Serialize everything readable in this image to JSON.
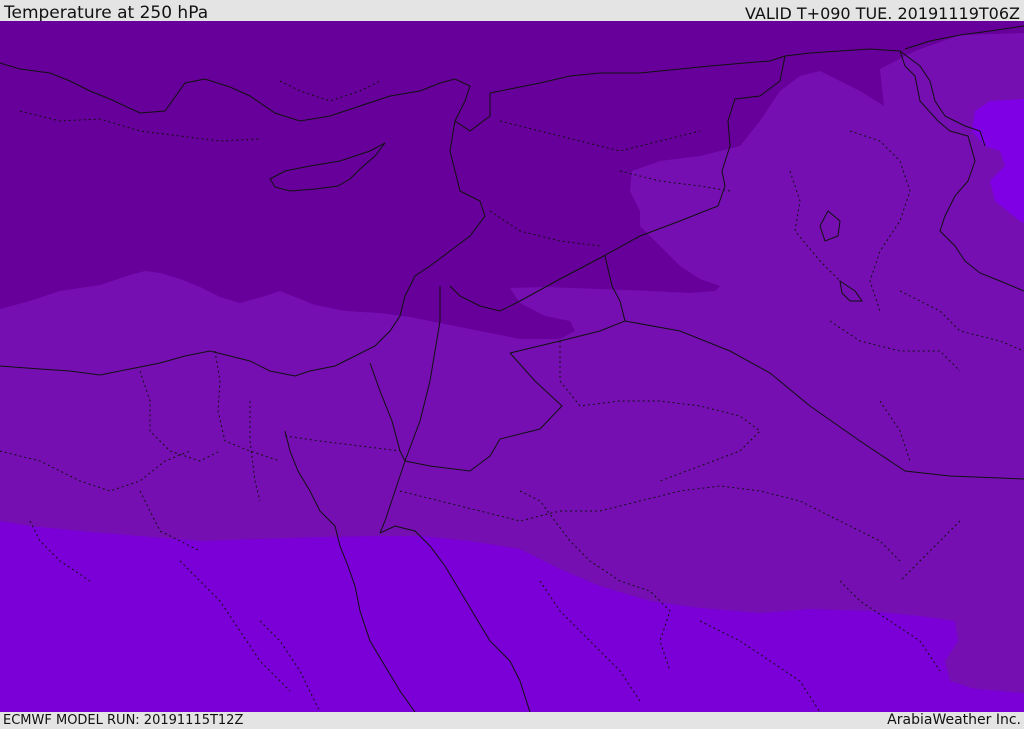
{
  "header": {
    "title": "Temperature at 250 hPa",
    "valid": "VALID T+090 TUE. 20191119T06Z"
  },
  "footer": {
    "model_run": "ECMWF MODEL RUN: 20191115T12Z",
    "credit": "ArabiaWeather Inc."
  },
  "map": {
    "field": "Temperature at 250 hPa",
    "colors": {
      "band_cold": "#67009a",
      "band_mid": "#750fb2",
      "band_warm": "#7b00d8",
      "band_warmest": "#8000e6",
      "coast_border": "#111111"
    }
  }
}
